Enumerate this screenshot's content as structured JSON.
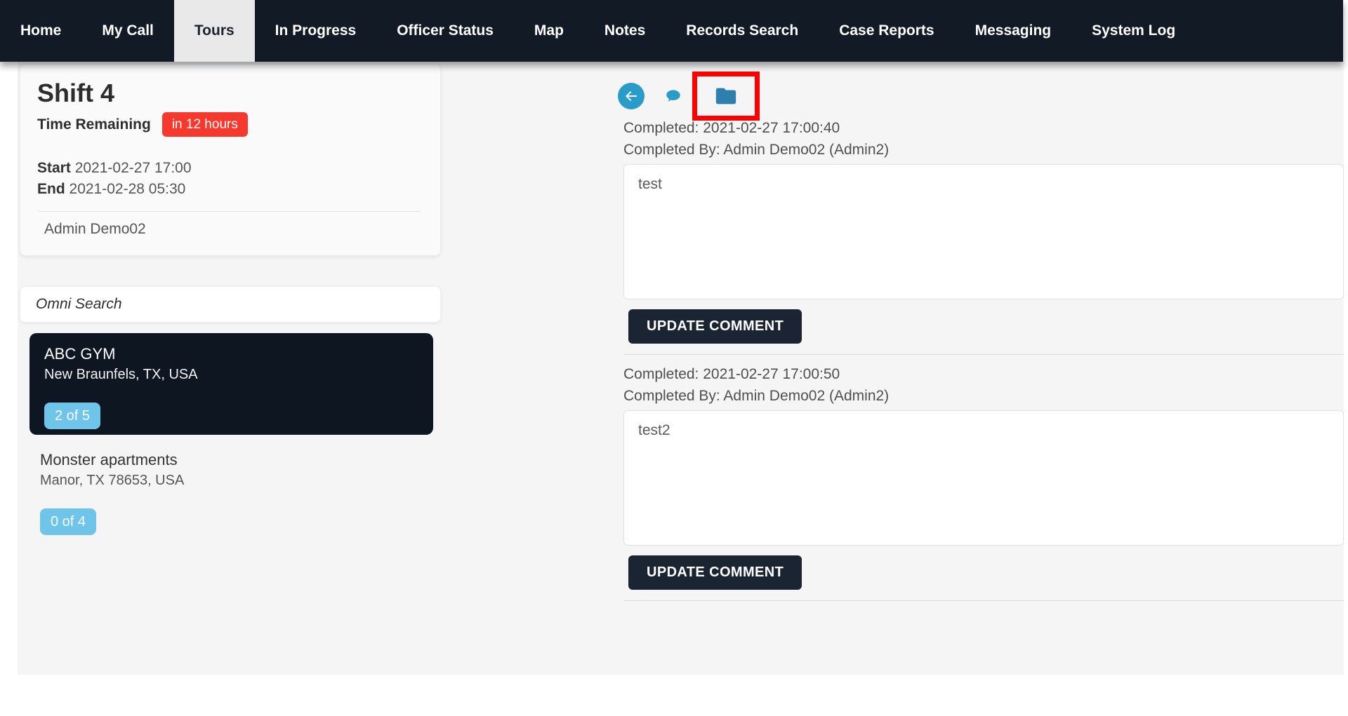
{
  "nav": {
    "items": [
      {
        "label": "Home",
        "active": false
      },
      {
        "label": "My Call",
        "active": false
      },
      {
        "label": "Tours",
        "active": true
      },
      {
        "label": "In Progress",
        "active": false
      },
      {
        "label": "Officer Status",
        "active": false
      },
      {
        "label": "Map",
        "active": false
      },
      {
        "label": "Notes",
        "active": false
      },
      {
        "label": "Records Search",
        "active": false
      },
      {
        "label": "Case Reports",
        "active": false
      },
      {
        "label": "Messaging",
        "active": false
      },
      {
        "label": "System Log",
        "active": false
      }
    ]
  },
  "shift_card": {
    "title": "Shift 4",
    "time_remaining_label": "Time Remaining",
    "time_remaining_value": "in 12 hours",
    "start_label": "Start",
    "start_value": "2021-02-27 17:00",
    "end_label": "End",
    "end_value": "2021-02-28 05:30",
    "officer": "Admin Demo02"
  },
  "search": {
    "placeholder": "Omni Search"
  },
  "tour_list": [
    {
      "name": "ABC GYM",
      "location": "New Braunfels, TX, USA",
      "progress": "2 of 5",
      "selected": true
    },
    {
      "name": "Monster apartments",
      "location": "Manor, TX 78653, USA",
      "progress": "0 of 4",
      "selected": false
    }
  ],
  "detail_toolbar": {
    "icons": [
      {
        "name": "back-icon",
        "highlighted": false
      },
      {
        "name": "comment-icon",
        "highlighted": false
      },
      {
        "name": "folder-icon",
        "highlighted": true
      }
    ],
    "highlight_color": "#fd0000"
  },
  "comments": [
    {
      "completed_label": "Completed:",
      "completed_time": "2021-02-27 17:00:40",
      "completed_by_label": "Completed By:",
      "completed_by_value": "Admin Demo02 (Admin2)",
      "text": "test",
      "button_label": "UPDATE COMMENT"
    },
    {
      "completed_label": "Completed:",
      "completed_time": "2021-02-27 17:00:50",
      "completed_by_label": "Completed By:",
      "completed_by_value": "Admin Demo02 (Admin2)",
      "text": "test2",
      "button_label": "UPDATE COMMENT"
    }
  ],
  "colors": {
    "navbar_bg": "#121b25",
    "active_tab_bg": "#e9e9e9",
    "accent_blue": "#2a9cc8",
    "badge_red": "#f6392c",
    "badge_blue": "#6fc5e9",
    "dark_card_bg": "#0d1621",
    "button_bg": "#1b2433",
    "highlight_red": "#fd0000",
    "panel_bg": "#f5f5f6"
  }
}
